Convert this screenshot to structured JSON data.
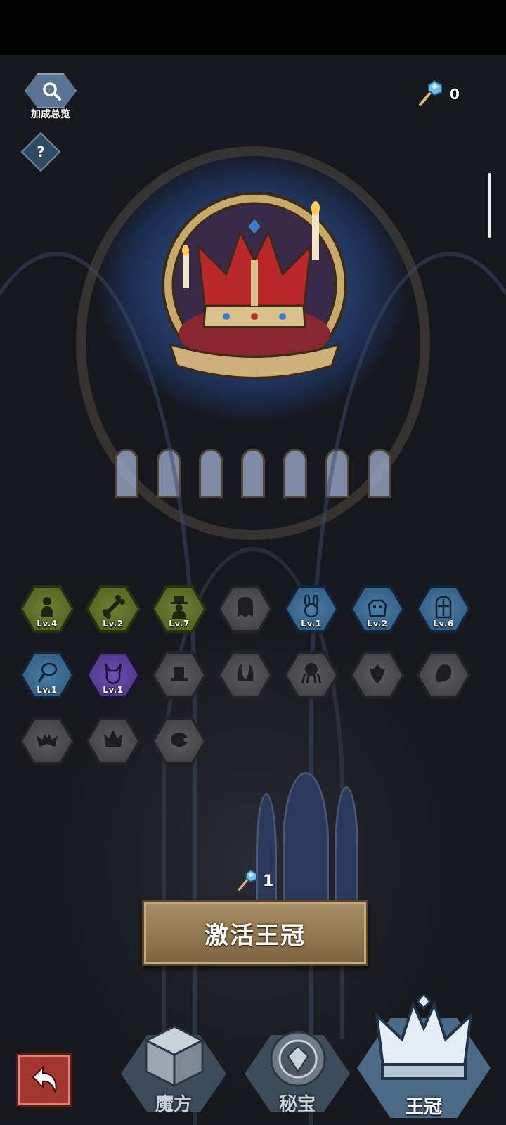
{
  "header": {
    "bonus_overview_label": "加成总览",
    "help_label": "?",
    "currency": {
      "icon": "gem-scepter-icon",
      "value": "0"
    }
  },
  "crowns": [
    {
      "icon": "silhouette-figure-icon",
      "state": "green",
      "level": "Lv.4"
    },
    {
      "icon": "bone-icon",
      "state": "green",
      "level": "Lv.2"
    },
    {
      "icon": "hat-man-icon",
      "state": "green",
      "level": "Lv.7"
    },
    {
      "icon": "ghost-icon",
      "state": "locked",
      "level": ""
    },
    {
      "icon": "rabbit-icon",
      "state": "blue",
      "level": "Lv.1"
    },
    {
      "icon": "ogre-icon",
      "state": "blue",
      "level": "Lv.2"
    },
    {
      "icon": "knight-helmet-icon",
      "state": "blue",
      "level": "Lv.6"
    },
    {
      "icon": "meat-club-icon",
      "state": "blue",
      "level": "Lv.1"
    },
    {
      "icon": "horned-demon-icon",
      "state": "purple",
      "level": "Lv.1"
    },
    {
      "icon": "magic-hat-icon",
      "state": "locked",
      "level": ""
    },
    {
      "icon": "horns-icon",
      "state": "locked",
      "level": ""
    },
    {
      "icon": "octopus-icon",
      "state": "locked",
      "level": ""
    },
    {
      "icon": "flame-crest-icon",
      "state": "locked",
      "level": ""
    },
    {
      "icon": "spirit-icon",
      "state": "locked",
      "level": ""
    },
    {
      "icon": "bat-icon",
      "state": "locked",
      "level": ""
    },
    {
      "icon": "crown-icon",
      "state": "locked",
      "level": ""
    },
    {
      "icon": "pig-icon",
      "state": "locked",
      "level": ""
    }
  ],
  "activation": {
    "cost_icon": "gem-scepter-icon",
    "cost_value": "1",
    "button_label": "激活王冠"
  },
  "bottom_nav": {
    "back_icon": "back-arrow-icon",
    "tabs": [
      {
        "label": "魔方",
        "icon": "cube-icon",
        "active": false
      },
      {
        "label": "秘宝",
        "icon": "gem-medallion-icon",
        "active": false
      },
      {
        "label": "王冠",
        "icon": "crown-icon",
        "active": true
      }
    ]
  },
  "colors": {
    "green_tile": "#5f6f28",
    "blue_tile": "#3b6a90",
    "purple_tile": "#5b3e98",
    "locked_tile": "#4a4a4e",
    "activate_button": "#9b8259",
    "back_button": "#a3362e"
  }
}
